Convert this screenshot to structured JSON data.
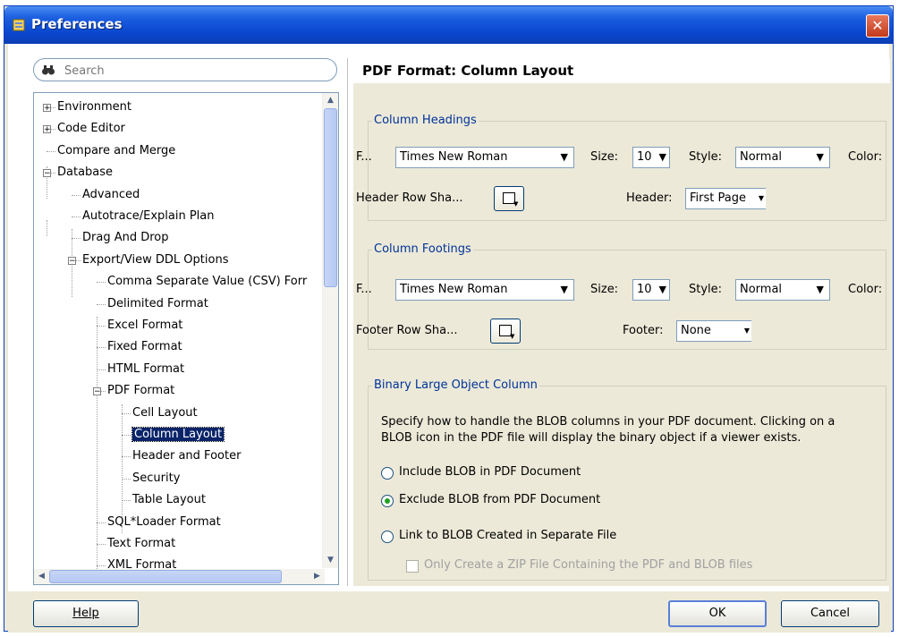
{
  "window": {
    "title": "Preferences"
  },
  "search": {
    "placeholder": "Search"
  },
  "tree": [
    {
      "label": "Environment",
      "level": 0,
      "expander": "plus"
    },
    {
      "label": "Code Editor",
      "level": 0,
      "expander": "plus"
    },
    {
      "label": "Compare and Merge",
      "level": 0,
      "expander": "none"
    },
    {
      "label": "Database",
      "level": 0,
      "expander": "minus"
    },
    {
      "label": "Advanced",
      "level": 1,
      "expander": "none"
    },
    {
      "label": "Autotrace/Explain Plan",
      "level": 1,
      "expander": "none"
    },
    {
      "label": "Drag And Drop",
      "level": 1,
      "expander": "none"
    },
    {
      "label": "Export/View DDL Options",
      "level": 1,
      "expander": "minus"
    },
    {
      "label": "Comma Separate Value (CSV) Forr",
      "level": 2,
      "expander": "none"
    },
    {
      "label": "Delimited Format",
      "level": 2,
      "expander": "none"
    },
    {
      "label": "Excel Format",
      "level": 2,
      "expander": "none"
    },
    {
      "label": "Fixed Format",
      "level": 2,
      "expander": "none"
    },
    {
      "label": "HTML Format",
      "level": 2,
      "expander": "none"
    },
    {
      "label": "PDF Format",
      "level": 2,
      "expander": "minus"
    },
    {
      "label": "Cell Layout",
      "level": 3,
      "expander": "none"
    },
    {
      "label": "Column Layout",
      "level": 3,
      "expander": "none",
      "selected": true
    },
    {
      "label": "Header and Footer",
      "level": 3,
      "expander": "none"
    },
    {
      "label": "Security",
      "level": 3,
      "expander": "none"
    },
    {
      "label": "Table Layout",
      "level": 3,
      "expander": "none"
    },
    {
      "label": "SQL*Loader Format",
      "level": 2,
      "expander": "none"
    },
    {
      "label": "Text Format",
      "level": 2,
      "expander": "none"
    },
    {
      "label": "XML Format",
      "level": 2,
      "expander": "none"
    }
  ],
  "page": {
    "title": "PDF Format: Column Layout"
  },
  "headings": {
    "group_label": "Column Headings",
    "font_label": "F...",
    "font_value": "Times New Roman",
    "size_label": "Size:",
    "size_value": "10",
    "style_label": "Style:",
    "style_value": "Normal",
    "color_label": "Color:",
    "shade_label": "Header Row Sha...",
    "header_label": "Header:",
    "header_value": "First Page"
  },
  "footings": {
    "group_label": "Column Footings",
    "font_label": "F...",
    "font_value": "Times New Roman",
    "size_label": "Size:",
    "size_value": "10",
    "style_label": "Style:",
    "style_value": "Normal",
    "color_label": "Color:",
    "shade_label": "Footer Row Sha...",
    "footer_label": "Footer:",
    "footer_value": "None"
  },
  "blob": {
    "group_label": "Binary Large Object Column",
    "description_line1": "Specify how to handle the BLOB columns in your PDF document.  Clicking on a",
    "description_line2": "BLOB icon in the PDF file will display the binary object if a viewer exists.",
    "option_include": "Include BLOB in PDF Document",
    "option_exclude": "Exclude BLOB from PDF Document",
    "option_link": "Link to BLOB Created in Separate File",
    "zip_option": "Only Create a ZIP File Containing the PDF and BLOB files",
    "selected": "exclude"
  },
  "buttons": {
    "help": "Help",
    "ok": "OK",
    "cancel": "Cancel"
  },
  "colors": {
    "title_bar": "#0a47cf",
    "selection": "#0a246a",
    "group_label": "#003399",
    "dialog_bg": "#ece9d8"
  }
}
